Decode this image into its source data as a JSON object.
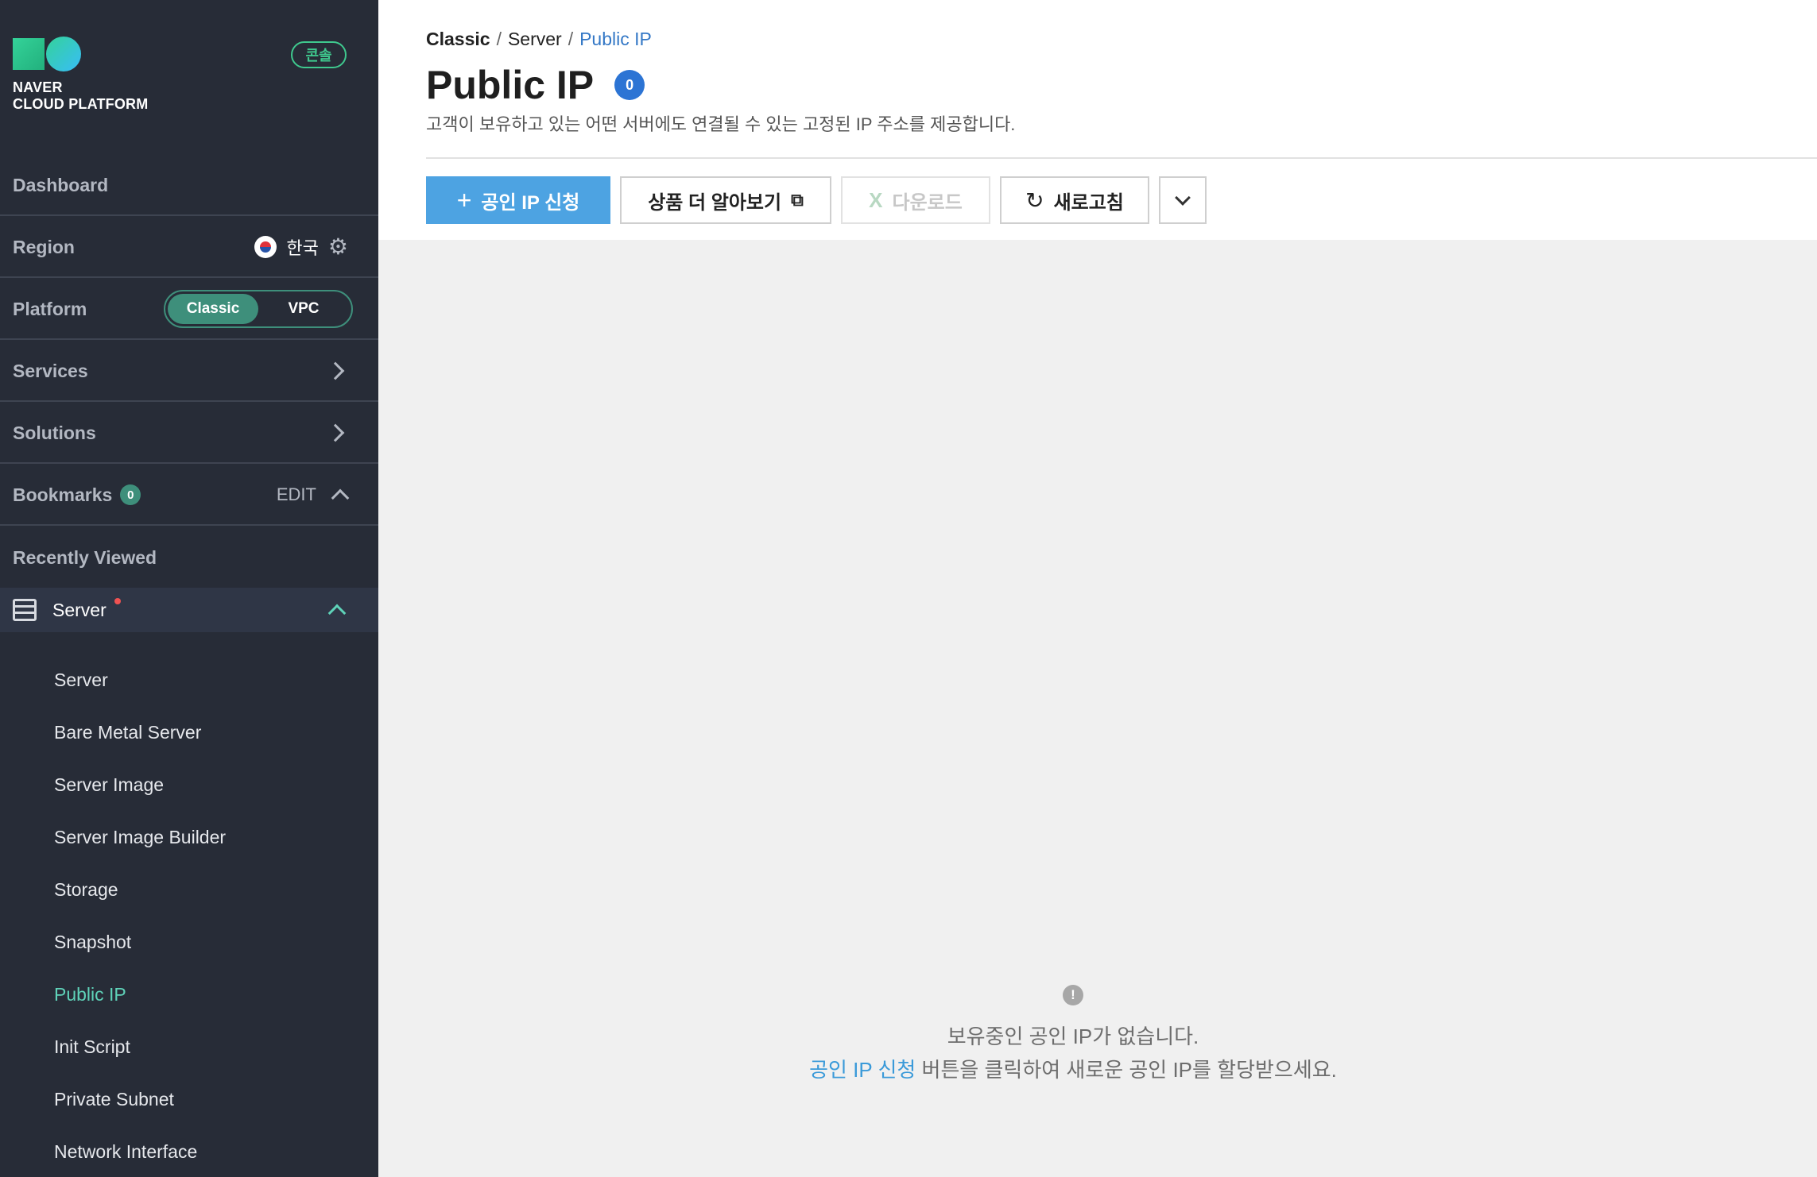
{
  "brand": {
    "line1": "NAVER",
    "line2": "CLOUD PLATFORM",
    "console_badge": "콘솔"
  },
  "sidebar": {
    "dashboard": "Dashboard",
    "region": {
      "label": "Region",
      "value": "한국"
    },
    "platform": {
      "label": "Platform",
      "options": [
        "Classic",
        "VPC"
      ],
      "selected": "Classic"
    },
    "services": "Services",
    "solutions": "Solutions",
    "bookmarks": {
      "label": "Bookmarks",
      "count": "0",
      "edit": "EDIT"
    },
    "recently_viewed": "Recently Viewed",
    "group": {
      "label": "Server",
      "expanded": true
    },
    "items": [
      {
        "label": "Server"
      },
      {
        "label": "Bare Metal Server"
      },
      {
        "label": "Server Image"
      },
      {
        "label": "Server Image Builder"
      },
      {
        "label": "Storage"
      },
      {
        "label": "Snapshot"
      },
      {
        "label": "Public IP",
        "active": true
      },
      {
        "label": "Init Script"
      },
      {
        "label": "Private Subnet"
      },
      {
        "label": "Network Interface"
      }
    ]
  },
  "breadcrumb": [
    "Classic",
    "Server",
    "Public IP"
  ],
  "page": {
    "title": "Public IP",
    "count": "0",
    "description": "고객이 보유하고 있는 어떤 서버에도 연결될 수 있는 고정된 IP 주소를 제공합니다."
  },
  "toolbar": {
    "apply": "공인 IP 신청",
    "learn_more": "상품 더 알아보기",
    "download": "다운로드",
    "refresh": "새로고침"
  },
  "empty_state": {
    "line1": "보유중인 공인 IP가 없습니다.",
    "link": "공인 IP 신청",
    "line2_rest": " 버튼을 클릭하여 새로운 공인 IP를 할당받으세요."
  },
  "colors": {
    "sidebar_bg": "#272c37",
    "accent_green": "#3e8f7b",
    "primary_blue": "#4da3e2",
    "active_item": "#5fd3b9"
  }
}
